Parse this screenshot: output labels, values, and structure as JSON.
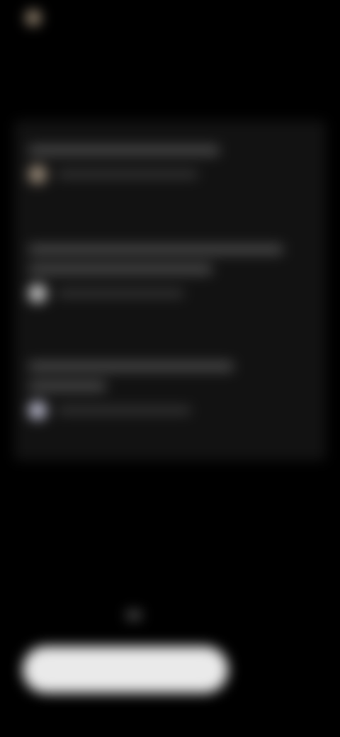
{
  "header": {
    "logo_text": "",
    "logo_color": "#9a8a75"
  },
  "feed": {
    "posts": [
      {
        "avatar_color": "#9b8c7a"
      },
      {
        "avatar_color": "#c8c8c8"
      },
      {
        "avatar_color": "#b9b9cc"
      }
    ]
  },
  "onboarding": {
    "heading": "",
    "subtext": "",
    "page_indicator": "page-dot-icon"
  },
  "actions": {
    "primary_label": "",
    "secondary_label": ""
  },
  "colors": {
    "background": "#000000",
    "card": "#121212",
    "primary_button": "#eaeaea"
  }
}
